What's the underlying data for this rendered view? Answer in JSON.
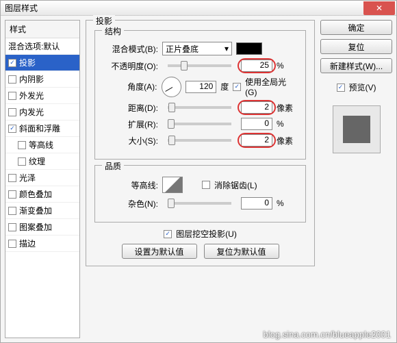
{
  "window": {
    "title": "图层样式"
  },
  "sidebar": {
    "header": "样式",
    "blendLabel": "混合选项:默认",
    "items": [
      {
        "label": "投影",
        "checked": true,
        "selected": true
      },
      {
        "label": "内阴影",
        "checked": false
      },
      {
        "label": "外发光",
        "checked": false
      },
      {
        "label": "内发光",
        "checked": false
      },
      {
        "label": "斜面和浮雕",
        "checked": true
      },
      {
        "label": "等高线",
        "checked": false,
        "indent": true
      },
      {
        "label": "纹理",
        "checked": false,
        "indent": true
      },
      {
        "label": "光泽",
        "checked": false
      },
      {
        "label": "颜色叠加",
        "checked": false
      },
      {
        "label": "渐变叠加",
        "checked": false
      },
      {
        "label": "图案叠加",
        "checked": false
      },
      {
        "label": "描边",
        "checked": false
      }
    ]
  },
  "panel": {
    "title": "投影",
    "structure": {
      "legend": "结构",
      "blendModeLabel": "混合模式(B):",
      "blendModeValue": "正片叠底",
      "opacityLabel": "不透明度(O):",
      "opacityValue": "25",
      "opacityUnit": "%",
      "angleLabel": "角度(A):",
      "angleValue": "120",
      "angleUnit": "度",
      "globalLightLabel": "使用全局光(G)",
      "distanceLabel": "距离(D):",
      "distanceValue": "2",
      "distanceUnit": "像素",
      "spreadLabel": "扩展(R):",
      "spreadValue": "0",
      "spreadUnit": "%",
      "sizeLabel": "大小(S):",
      "sizeValue": "2",
      "sizeUnit": "像素"
    },
    "quality": {
      "legend": "品质",
      "contourLabel": "等高线:",
      "antiAliasLabel": "消除锯齿(L)",
      "noiseLabel": "杂色(N):",
      "noiseValue": "0",
      "noiseUnit": "%"
    },
    "knockoutLabel": "图层挖空投影(U)",
    "setDefault": "设置为默认值",
    "resetDefault": "复位为默认值"
  },
  "buttons": {
    "ok": "确定",
    "cancel": "复位",
    "newStyle": "新建样式(W)...",
    "previewLabel": "预览(V)"
  },
  "watermark": "blog.sina.com.cn/blueapple2001"
}
